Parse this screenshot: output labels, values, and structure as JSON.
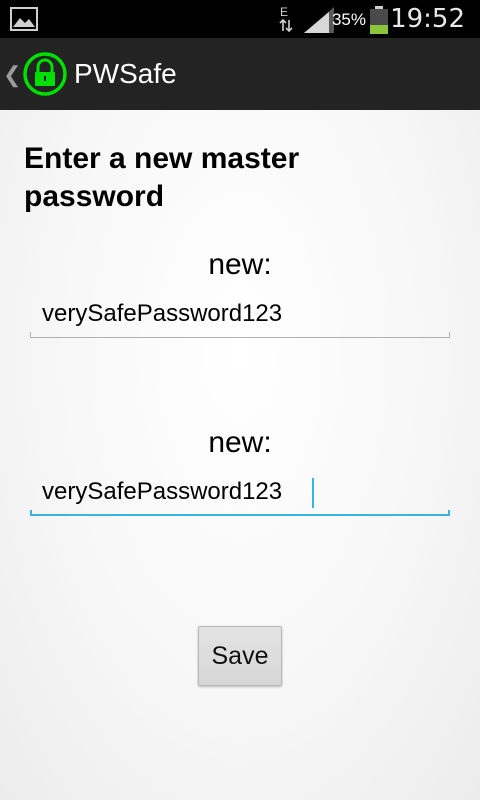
{
  "status_bar": {
    "network_type": "E",
    "battery_percent": "35%",
    "time": "19:52",
    "icons": [
      "gallery-icon",
      "network-activity-icon",
      "signal-icon",
      "battery-icon"
    ]
  },
  "action_bar": {
    "title": "PWSafe",
    "app_icon": "lock-icon",
    "accent_color": "#00e000"
  },
  "form": {
    "heading": "Enter a new master password",
    "field1": {
      "label": "new:",
      "value": "verySafePassword123"
    },
    "field2": {
      "label": "new:",
      "value": "verySafePassword123"
    },
    "save_label": "Save",
    "focus_color": "#33b5e5"
  }
}
